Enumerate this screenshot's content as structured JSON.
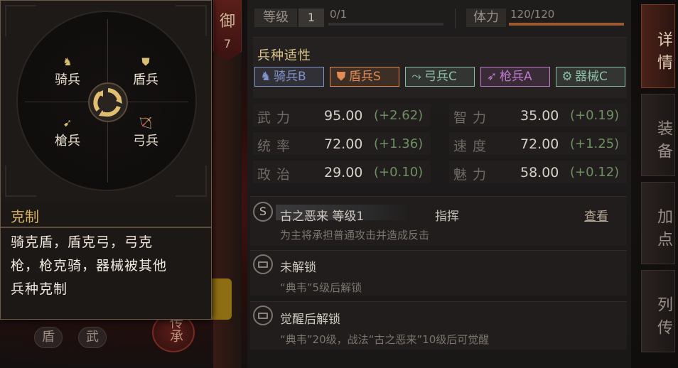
{
  "popup": {
    "units": {
      "cavalry": "骑兵",
      "shield": "盾兵",
      "spear": "槍兵",
      "bow": "弓兵"
    },
    "title": "克制",
    "body_lines": [
      "骑克盾，盾克弓，弓克",
      "枪，枪克骑，器械被其他",
      "兵种克制"
    ]
  },
  "side": {
    "yu_char": "御",
    "yu_num": "7",
    "chuan": "传承",
    "bottom_btns": [
      "盾",
      "武"
    ]
  },
  "header": {
    "level_label": "等级",
    "level_value": "1",
    "exp_text": "0/1",
    "exp_fraction": 0.0,
    "stamina_label": "体力",
    "stamina_text": "120/120",
    "stamina_fraction": 1.0
  },
  "troops": {
    "title": "兵种适性",
    "chips": [
      {
        "icon": "horse",
        "label": "骑兵B",
        "color": "#7f95c9"
      },
      {
        "icon": "shield",
        "label": "盾兵S",
        "color": "#e08a55"
      },
      {
        "icon": "bow",
        "label": "弓兵C",
        "color": "#8cbda5"
      },
      {
        "icon": "spear",
        "label": "枪兵A",
        "color": "#c07acc"
      },
      {
        "icon": "gear",
        "label": "器械C",
        "color": "#8cbda5"
      }
    ]
  },
  "stats": [
    {
      "name": "武力",
      "value": "95.00",
      "bonus": "(+2.62)"
    },
    {
      "name": "智力",
      "value": "35.00",
      "bonus": "(+0.19)"
    },
    {
      "name": "统率",
      "value": "72.00",
      "bonus": "(+1.36)"
    },
    {
      "name": "速度",
      "value": "72.00",
      "bonus": "(+1.25)"
    },
    {
      "name": "政治",
      "value": "29.00",
      "bonus": "(+0.10)"
    },
    {
      "name": "魅力",
      "value": "58.00",
      "bonus": "(+0.12)"
    }
  ],
  "skills": [
    {
      "badge": "S",
      "name": "古之恶来 等级1",
      "type": "指挥",
      "link": "查看",
      "desc": "为主将承担普通攻击并造成反击"
    },
    {
      "name": "未解锁",
      "desc": "“典韦”5级后解锁"
    },
    {
      "name": "觉醒后解锁",
      "desc": "“典韦”20级，战法“古之恶来”10级后可觉醒"
    }
  ],
  "tabs": [
    {
      "label": "详情",
      "active": true
    },
    {
      "label": "装备"
    },
    {
      "label": "加点"
    },
    {
      "label": "列传"
    }
  ]
}
